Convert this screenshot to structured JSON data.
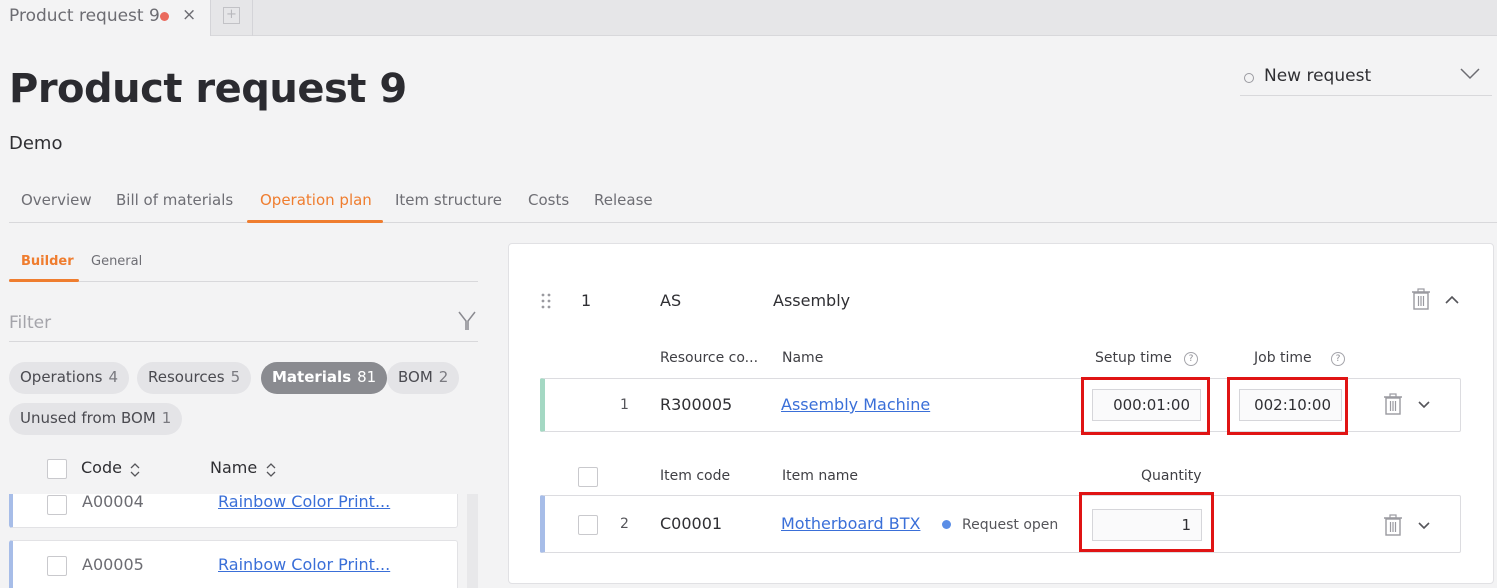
{
  "tabstrip": {
    "active_tab_label": "Product request 9",
    "modified_color": "#ea6a5d",
    "close_glyph": "×",
    "add_tab_glyph": "+"
  },
  "header": {
    "title": "Product request 9",
    "subtitle": "Demo",
    "status": {
      "label": "New request",
      "icon": "circle-outline-icon"
    }
  },
  "main_tabs": [
    {
      "label": "Overview",
      "active": false
    },
    {
      "label": "Bill of materials",
      "active": false
    },
    {
      "label": "Operation plan",
      "active": true
    },
    {
      "label": "Item structure",
      "active": false
    },
    {
      "label": "Costs",
      "active": false
    },
    {
      "label": "Release",
      "active": false
    }
  ],
  "left_panel": {
    "sub_tabs": [
      {
        "label": "Builder",
        "active": true
      },
      {
        "label": "General",
        "active": false
      }
    ],
    "filter_placeholder": "Filter",
    "chips": [
      {
        "label": "Operations",
        "count": "4",
        "active": false
      },
      {
        "label": "Resources",
        "count": "5",
        "active": false
      },
      {
        "label": "Materials",
        "count": "81",
        "active": true
      },
      {
        "label": "BOM",
        "count": "2",
        "active": false
      },
      {
        "label": "Unused from BOM",
        "count": "1",
        "active": false
      }
    ],
    "list_columns": {
      "code": "Code",
      "name": "Name"
    },
    "materials": [
      {
        "code": "A00004",
        "name": "Rainbow Color Print..."
      },
      {
        "code": "A00005",
        "name": "Rainbow Color Print..."
      }
    ]
  },
  "operation": {
    "position": "1",
    "code": "AS",
    "name": "Assembly",
    "resource_section": {
      "columns": {
        "resource_code": "Resource co...",
        "name": "Name",
        "setup_time": "Setup time",
        "job_time": "Job time",
        "help_glyph": "?"
      },
      "rows": [
        {
          "pos": "1",
          "resource_code": "R300005",
          "name": "Assembly Machine",
          "setup_time": "000:01:00",
          "job_time": "002:10:00"
        }
      ]
    },
    "material_section": {
      "columns": {
        "item_code": "Item code",
        "item_name": "Item name",
        "quantity": "Quantity"
      },
      "rows": [
        {
          "pos": "2",
          "item_code": "C00001",
          "item_name": "Motherboard BTX",
          "status": "Request open",
          "quantity": "1"
        }
      ]
    }
  },
  "colors": {
    "accent": "#ef7d2f",
    "link": "#3a6fd8",
    "highlight": "#e01414",
    "resource_stripe": "#a4d8c3",
    "material_stripe": "#a7bde8"
  }
}
